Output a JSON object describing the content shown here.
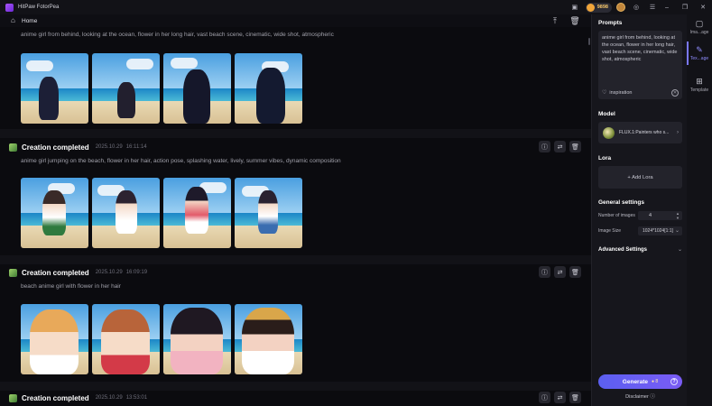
{
  "app": {
    "title": "HitPaw FotorPea"
  },
  "titlebar": {
    "coins": "9898",
    "icons": [
      "gift-icon",
      "avatar",
      "help-icon",
      "menu-icon"
    ],
    "window_controls": [
      "minimize-icon",
      "maximize-icon",
      "close-icon"
    ]
  },
  "breadcrumb": {
    "home_label": "Home"
  },
  "feed": {
    "sections": [
      {
        "prompt": "anime girl from behind, looking at the ocean, flower in her long hair, vast beach scene, cinematic, wide shot, atmospheric"
      },
      {
        "status": "Creation completed",
        "date": "2025.10.29",
        "time": "16:11:14",
        "prompt": "anime girl jumping on the beach, flower in her hair, action pose, splashing water, lively, summer vibes, dynamic composition"
      },
      {
        "status": "Creation completed",
        "date": "2025.10.29",
        "time": "16:09:19",
        "prompt": "beach anime girl with flower in her hair"
      },
      {
        "status": "Creation completed",
        "date": "2025.10.29",
        "time": "13:53:01"
      }
    ],
    "action_icons": [
      "info-icon",
      "regenerate-icon",
      "delete-icon"
    ]
  },
  "panel": {
    "prompts_label": "Prompts",
    "prompt_value": "anime girl from behind, looking at the ocean, flower in her long hair, vast beach scene, cinematic, wide shot, atmospheric",
    "inspiration_label": "inspiration",
    "model_label": "Model",
    "model_name": "FLUX.1:Painters who s...",
    "lora_label": "Lora",
    "add_lora_label": "+ Add Lora",
    "general_settings_label": "General settings",
    "number_of_images_label": "Number of images",
    "number_of_images_value": "4",
    "image_size_label": "Image Size",
    "image_size_value": "1024*1024[1:1]",
    "advanced_settings_label": "Advanced Settings",
    "generate_label": "Generate",
    "generate_cost": "8",
    "disclaimer_label": "Disclaimer"
  },
  "rail": {
    "items": [
      {
        "label": "Ima...age",
        "icon": "image-to-image-icon"
      },
      {
        "label": "Tex...age",
        "icon": "text-to-image-icon",
        "active": true
      },
      {
        "label": "Template",
        "icon": "template-icon"
      }
    ]
  },
  "colors": {
    "accent": "#7a5cf5",
    "background": "#0b0b0f",
    "panel": "#16161c",
    "coin": "#f0a53a"
  }
}
